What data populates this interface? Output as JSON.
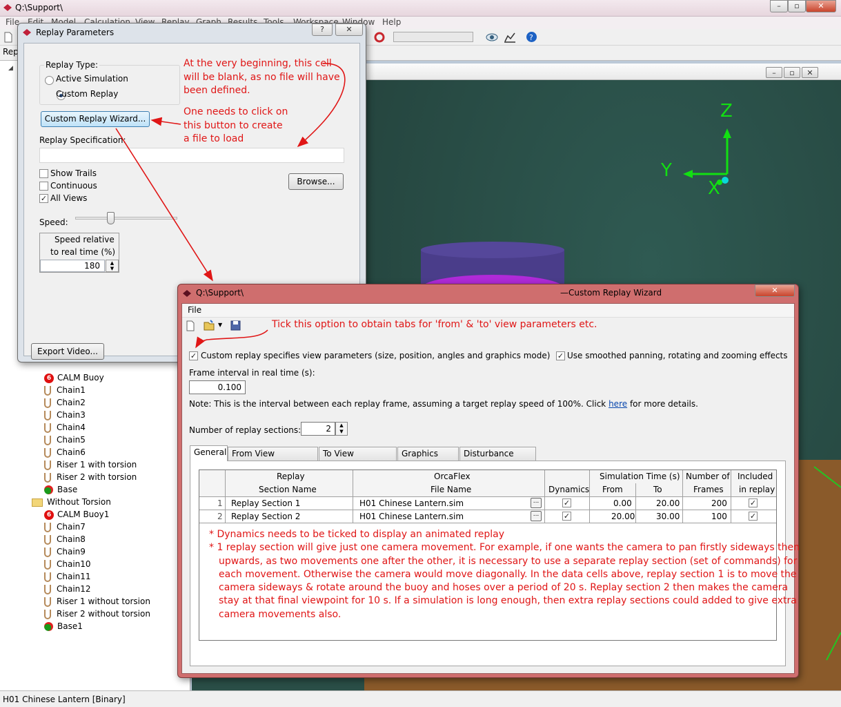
{
  "main": {
    "title": "Q:\\Support\\",
    "menu": [
      "File",
      "Edit",
      "Model",
      "Calculation",
      "View",
      "Replay",
      "Graph",
      "Results",
      "Tools",
      "Workspace",
      "Window",
      "Help"
    ],
    "tab_stub": "Repl",
    "status": "H01 Chinese Lantern [Binary]"
  },
  "tree": {
    "items": [
      {
        "label": "CALM Buoy",
        "icon": "buoy-icon"
      },
      {
        "label": "Chain1",
        "icon": "chain-icon"
      },
      {
        "label": "Chain2",
        "icon": "chain-icon"
      },
      {
        "label": "Chain3",
        "icon": "chain-icon"
      },
      {
        "label": "Chain4",
        "icon": "chain-icon"
      },
      {
        "label": "Chain5",
        "icon": "chain-icon"
      },
      {
        "label": "Chain6",
        "icon": "chain-icon"
      },
      {
        "label": "Riser 1 with torsion",
        "icon": "chain-icon"
      },
      {
        "label": "Riser 2 with torsion",
        "icon": "chain-icon"
      },
      {
        "label": "Base",
        "icon": "base-icon"
      },
      {
        "label": "Without Torsion",
        "icon": "folder-icon"
      },
      {
        "label": "CALM Buoy1",
        "icon": "buoy-icon"
      },
      {
        "label": "Chain7",
        "icon": "chain-icon"
      },
      {
        "label": "Chain8",
        "icon": "chain-icon"
      },
      {
        "label": "Chain9",
        "icon": "chain-icon"
      },
      {
        "label": "Chain10",
        "icon": "chain-icon"
      },
      {
        "label": "Chain11",
        "icon": "chain-icon"
      },
      {
        "label": "Chain12",
        "icon": "chain-icon"
      },
      {
        "label": "Riser 1 without torsion",
        "icon": "chain-icon"
      },
      {
        "label": "Riser 2 without torsion",
        "icon": "chain-icon"
      },
      {
        "label": "Base1",
        "icon": "base-icon"
      }
    ]
  },
  "view3d": {
    "axis_z": "Z",
    "axis_y": "Y",
    "axis_x": "X"
  },
  "replay_params": {
    "title": "Replay Parameters",
    "replay_type_label": "Replay Type:",
    "opt_active": "Active Simulation",
    "opt_custom": "Custom Replay",
    "wizard_button": "Custom Replay Wizard...",
    "spec_label": "Replay Specification:",
    "spec_value": "",
    "show_trails": "Show Trails",
    "continuous": "Continuous",
    "all_views": "All Views",
    "browse_button": "Browse...",
    "speed_label": "Speed:",
    "speed_rel_label_1": "Speed relative",
    "speed_rel_label_2": "to real time (%)",
    "speed_value": "180",
    "export_button": "Export Video...",
    "help_btn": "?",
    "close_btn": "✕"
  },
  "annotations": {
    "a1_l1": "At the very beginning, this cell",
    "a1_l2": "will be blank, as no file will have",
    "a1_l3": "been defined.",
    "a2_l1": "One needs to click on",
    "a2_l2": "this button to create",
    "a2_l3": "a file to load",
    "a3": "Tick this option to obtain tabs for 'from' & 'to' view parameters etc.",
    "note_l1": "* Dynamics needs to be ticked to display an animated replay",
    "note_l2": "* 1 replay section will give just one camera movement.  For example, if one wants the camera to pan firstly sideways then",
    "note_l3": "upwards, as two movements one after the other, it is necessary to use a separate replay section (set of commands) for",
    "note_l4": "each movement.  Otherwise the camera would move diagonally.  In the data cells above, replay section 1 is to move the",
    "note_l5": "camera sideways & rotate around the buoy and hoses over a period of 20 s.  Replay section 2 then makes the camera",
    "note_l6": "stay at that final viewpoint for 10 s.  If a simulation is long enough, then extra replay sections could added to give extra",
    "note_l7": "camera movements also."
  },
  "wizard": {
    "title_left": "Q:\\Support\\",
    "title_right": "—Custom Replay Wizard",
    "menu_file": "File",
    "chk_view_params": "Custom replay specifies view parameters (size, position, angles and graphics mode)",
    "chk_smoothed": "Use smoothed panning, rotating and zooming effects",
    "frame_label": "Frame interval in real time (s):",
    "frame_value": "0.100",
    "note_pre": "Note: This is the interval between each replay frame, assuming a target replay speed of 100%.  Click ",
    "note_link": "here",
    "note_post": " for more details.",
    "sections_label": "Number of replay sections:",
    "sections_value": "2",
    "tabs": [
      "General",
      "From View Parameters",
      "To View Parameters",
      "Graphics Mode",
      "Disturbance Vessel"
    ],
    "headers": {
      "h_section_1": "Replay",
      "h_section_2": "Section Name",
      "h_file_1": "OrcaFlex",
      "h_file_2": "File Name",
      "h_dyn": "Dynamics",
      "h_time": "Simulation Time (s)",
      "h_from": "From",
      "h_to": "To",
      "h_frames_1": "Number of",
      "h_frames_2": "Frames",
      "h_incl_1": "Included",
      "h_incl_2": "in replay"
    },
    "rows": [
      {
        "num": "1",
        "name": "Replay Section 1",
        "file": "H01 Chinese Lantern.sim",
        "from": "0.00",
        "to": "20.00",
        "frames": "200"
      },
      {
        "num": "2",
        "name": "Replay Section 2",
        "file": "H01 Chinese Lantern.sim",
        "from": "20.00",
        "to": "30.00",
        "frames": "100"
      }
    ],
    "ellipsis": "...",
    "close_btn": "✕"
  },
  "colors": {
    "annotation": "#e01616",
    "axis": "#12e012"
  }
}
